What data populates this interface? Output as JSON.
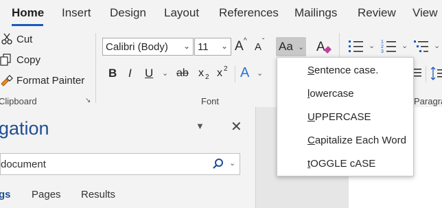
{
  "tabs": [
    {
      "label": "Home"
    },
    {
      "label": "Insert"
    },
    {
      "label": "Design"
    },
    {
      "label": "Layout"
    },
    {
      "label": "References"
    },
    {
      "label": "Mailings"
    },
    {
      "label": "Review"
    },
    {
      "label": "View"
    }
  ],
  "clipboard": {
    "cut_label": "Cut",
    "copy_label": "Copy",
    "format_painter_label": "Format Painter",
    "group_label": "Clipboard"
  },
  "font": {
    "font_name": "Calibri (Body)",
    "font_size": "11",
    "group_label": "Font",
    "grow_glyph": "A",
    "shrink_glyph": "A",
    "change_case_glyph": "Aa",
    "bold_glyph": "B",
    "italic_glyph": "I",
    "underline_glyph": "U",
    "strike_glyph": "ab",
    "subscript_glyph": "x",
    "subscript_mark": "2",
    "superscript_glyph": "x",
    "superscript_mark": "2",
    "text_effects_glyph": "A"
  },
  "paragraph": {
    "group_label": "Paragra"
  },
  "change_case_menu": {
    "items": [
      {
        "underlined": "S",
        "rest": "entence case."
      },
      {
        "underlined": "l",
        "rest": "owercase"
      },
      {
        "underlined": "U",
        "rest": "PPERCASE"
      },
      {
        "underlined": "C",
        "rest": "apitalize Each Word"
      },
      {
        "underlined": "t",
        "rest": "OGGLE cASE"
      }
    ]
  },
  "navigation": {
    "title": "igation",
    "search_value": "document",
    "tabs": [
      {
        "label": "gs"
      },
      {
        "label": "Pages"
      },
      {
        "label": "Results"
      }
    ]
  },
  "colors": {
    "accent": "#185abd",
    "nav_title": "#1f4e93"
  }
}
